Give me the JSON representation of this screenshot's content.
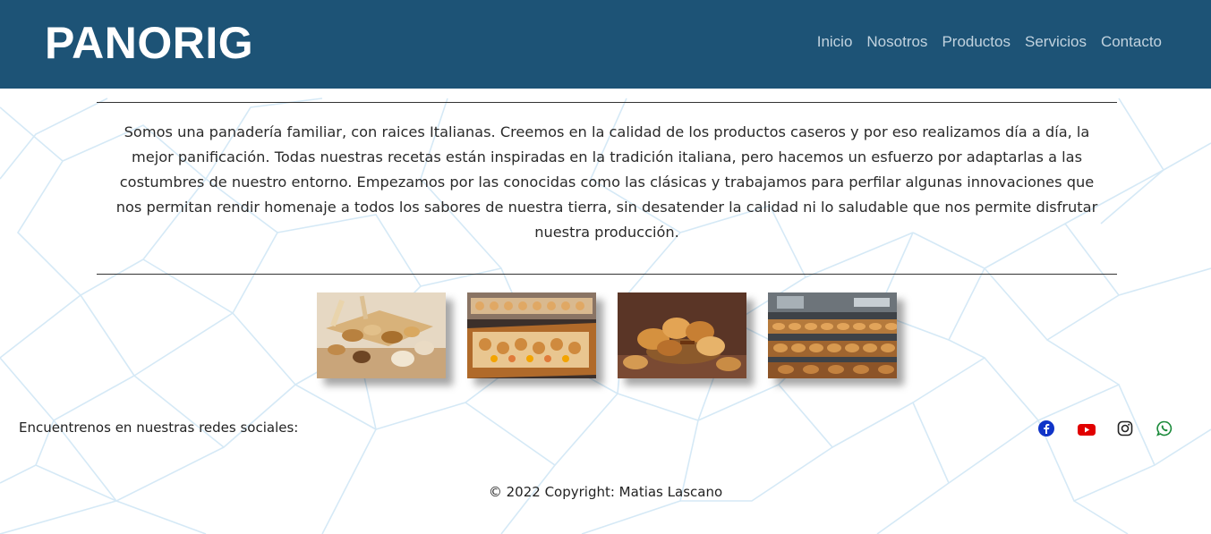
{
  "brand": {
    "logo_text": "PANORIG"
  },
  "nav": {
    "items": [
      {
        "label": "Inicio"
      },
      {
        "label": "Nosotros"
      },
      {
        "label": "Productos"
      },
      {
        "label": "Servicios"
      },
      {
        "label": "Contacto"
      }
    ]
  },
  "intro": {
    "text": "Somos una panadería familiar, con raices Italianas. Creemos en la calidad de los productos caseros y por eso realizamos día a día, la mejor panificación. Todas nuestras recetas están inspiradas en la tradición italiana, pero hacemos un esfuerzo por adaptarlas a las costumbres de nuestro entorno. Empezamos por las conocidas como las clásicas y trabajamos para perfilar algunas innovaciones que nos permitan rendir homenaje a todos los sabores de nuestra tierra, sin desatender la calidad ni lo saludable que nos permite disfrutar nuestra producción."
  },
  "gallery": {
    "images": [
      {
        "icon": "bread-assortment-photo"
      },
      {
        "icon": "pastry-display-photo"
      },
      {
        "icon": "croissant-basket-photo"
      },
      {
        "icon": "bakery-shelves-photo"
      }
    ]
  },
  "social": {
    "label": "Encuentrenos en nuestras redes sociales:",
    "links": [
      {
        "icon": "facebook-icon",
        "color": "#1877f2"
      },
      {
        "icon": "youtube-icon",
        "color": "#e10000"
      },
      {
        "icon": "instagram-icon",
        "color": "#222222"
      },
      {
        "icon": "whatsapp-icon",
        "color": "#1a8a3a"
      }
    ]
  },
  "footer": {
    "copyright": "© 2022 Copyright: Matias Lascano"
  },
  "colors": {
    "header": "#1d5376",
    "nav_text": "#c2d3df",
    "pattern": "#cfe6f5"
  }
}
